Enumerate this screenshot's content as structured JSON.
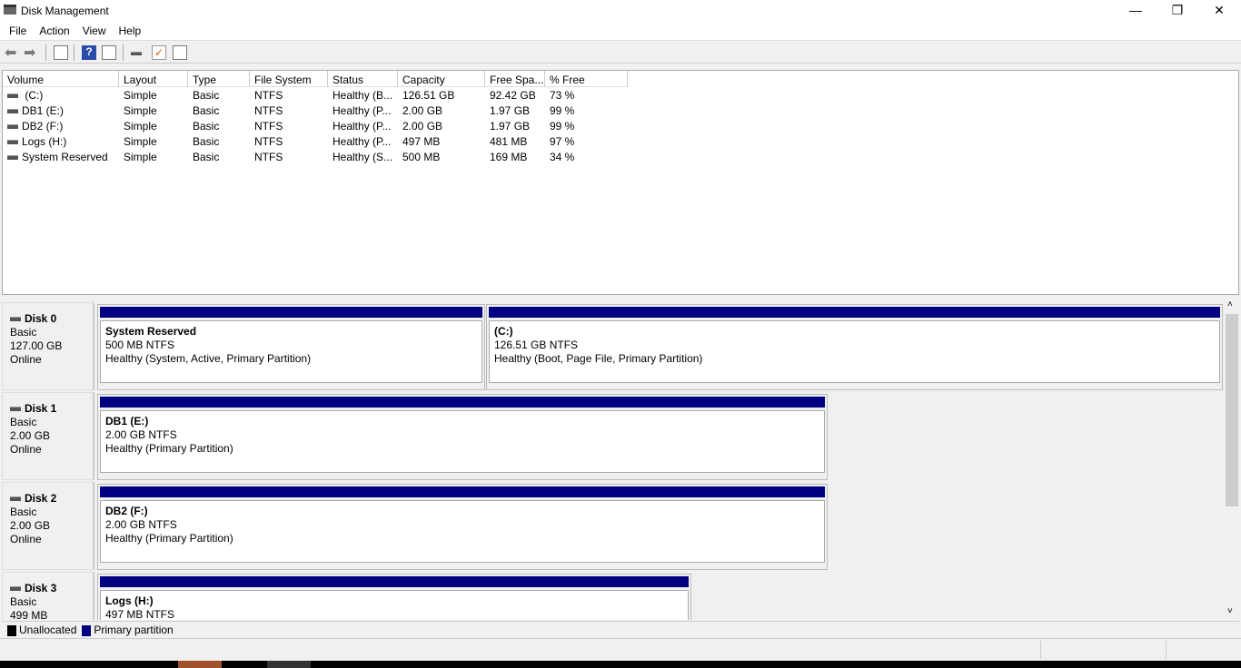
{
  "window": {
    "title": "Disk Management",
    "controls": {
      "minimize": "—",
      "restore": "❐",
      "close": "✕"
    }
  },
  "menu": [
    "File",
    "Action",
    "View",
    "Help"
  ],
  "toolbar": [
    "back-icon",
    "forward-icon",
    "console-tree-icon",
    "help-icon",
    "show-pane-icon",
    "rescan-icon",
    "checklist-icon",
    "properties-icon"
  ],
  "volume_list": {
    "columns": [
      "Volume",
      "Layout",
      "Type",
      "File System",
      "Status",
      "Capacity",
      "Free Spa...",
      "% Free"
    ],
    "rows": [
      [
        " (C:)",
        "Simple",
        "Basic",
        "NTFS",
        "Healthy (B...",
        "126.51 GB",
        "92.42 GB",
        "73 %"
      ],
      [
        "DB1 (E:)",
        "Simple",
        "Basic",
        "NTFS",
        "Healthy (P...",
        "2.00 GB",
        "1.97 GB",
        "99 %"
      ],
      [
        "DB2 (F:)",
        "Simple",
        "Basic",
        "NTFS",
        "Healthy (P...",
        "2.00 GB",
        "1.97 GB",
        "99 %"
      ],
      [
        "Logs (H:)",
        "Simple",
        "Basic",
        "NTFS",
        "Healthy (P...",
        "497 MB",
        "481 MB",
        "97 %"
      ],
      [
        "System Reserved",
        "Simple",
        "Basic",
        "NTFS",
        "Healthy (S...",
        "500 MB",
        "169 MB",
        "34 %"
      ]
    ]
  },
  "disks": [
    {
      "name": "Disk 0",
      "type": "Basic",
      "size": "127.00 GB",
      "state": "Online",
      "partitions": [
        {
          "name": "System Reserved",
          "size": "500 MB NTFS",
          "status": "Healthy (System, Active, Primary Partition)"
        },
        {
          "name": " (C:)",
          "size": "126.51 GB NTFS",
          "status": "Healthy (Boot, Page File, Primary Partition)"
        }
      ]
    },
    {
      "name": "Disk 1",
      "type": "Basic",
      "size": "2.00 GB",
      "state": "Online",
      "partitions": [
        {
          "name": "DB1  (E:)",
          "size": "2.00 GB NTFS",
          "status": "Healthy (Primary Partition)"
        }
      ]
    },
    {
      "name": "Disk 2",
      "type": "Basic",
      "size": "2.00 GB",
      "state": "Online",
      "partitions": [
        {
          "name": "DB2  (F:)",
          "size": "2.00 GB NTFS",
          "status": "Healthy (Primary Partition)"
        }
      ]
    },
    {
      "name": "Disk 3",
      "type": "Basic",
      "size": "499 MB",
      "state": "",
      "partitions": [
        {
          "name": "Logs  (H:)",
          "size": "497 MB NTFS",
          "status": ""
        }
      ]
    }
  ],
  "legend": [
    {
      "label": "Unallocated",
      "color": "#000000"
    },
    {
      "label": "Primary partition",
      "color": "#000080"
    }
  ],
  "colors": {
    "primary_partition": "#000080"
  }
}
